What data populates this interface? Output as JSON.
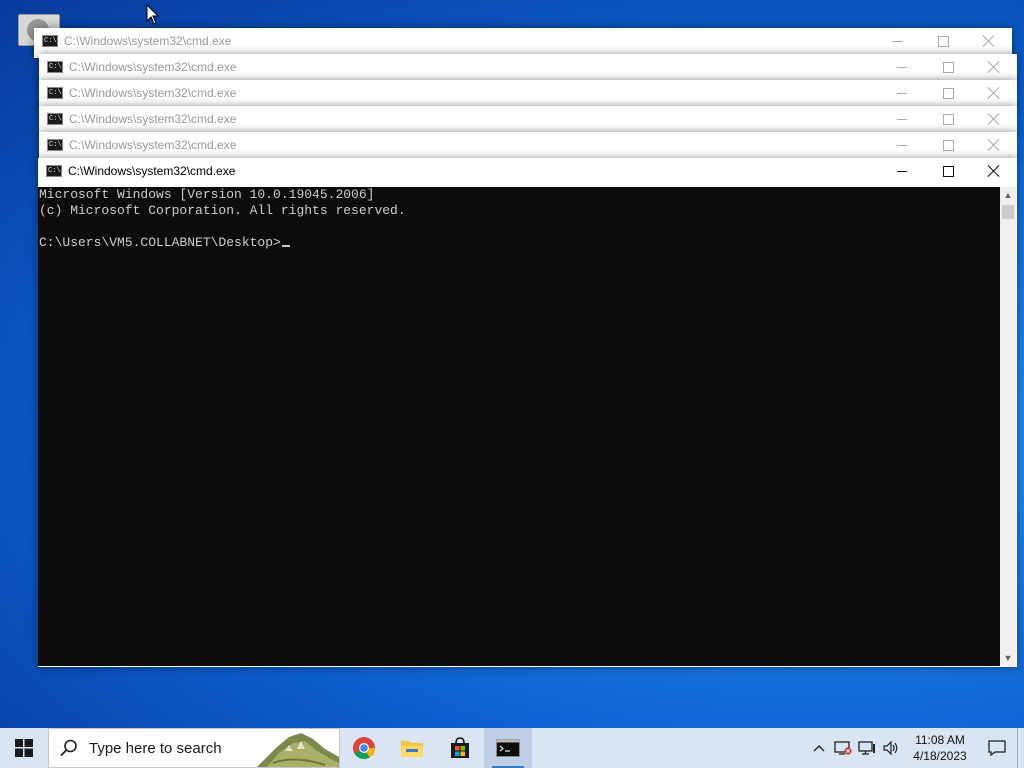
{
  "windows": [
    {
      "title": "C:\\Windows\\system32\\cmd.exe",
      "active": false
    },
    {
      "title": "C:\\Windows\\system32\\cmd.exe",
      "active": false
    },
    {
      "title": "C:\\Windows\\system32\\cmd.exe",
      "active": false
    },
    {
      "title": "C:\\Windows\\system32\\cmd.exe",
      "active": false
    },
    {
      "title": "C:\\Windows\\system32\\cmd.exe",
      "active": false
    },
    {
      "title": "C:\\Windows\\system32\\cmd.exe",
      "active": true
    }
  ],
  "window_icon": "cmd-icon",
  "window_icon_text": "C:\\.",
  "console": {
    "lines": [
      "Microsoft Windows [Version 10.0.19045.2006]",
      "(c) Microsoft Corporation. All rights reserved.",
      "",
      "C:\\Users\\VM5.COLLABNET\\Desktop>"
    ],
    "background": "#0c0c0c",
    "foreground": "#cccccc"
  },
  "taskbar": {
    "search_placeholder": "Type here to search",
    "apps": [
      {
        "name": "chrome-icon",
        "active": false
      },
      {
        "name": "file-explorer-icon",
        "active": false
      },
      {
        "name": "microsoft-store-icon",
        "active": false
      },
      {
        "name": "command-prompt-icon",
        "active": true
      }
    ],
    "clock_time": "11:08 AM",
    "clock_date": "4/18/2023"
  },
  "colors": {
    "taskbar": "#d9e5f3",
    "desktop": "#0b5bc9"
  }
}
